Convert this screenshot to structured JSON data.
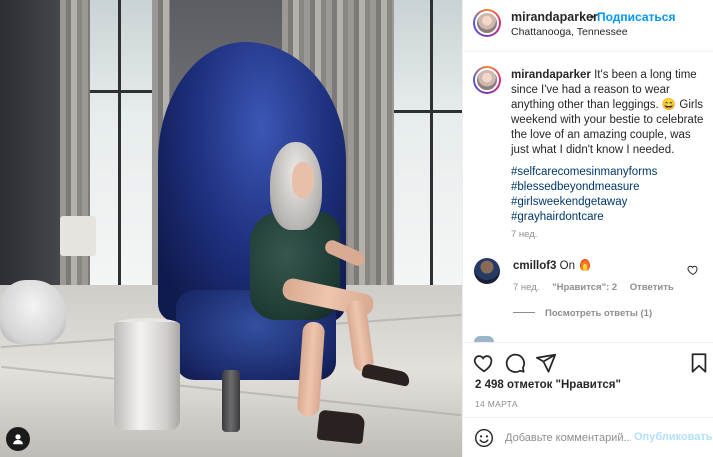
{
  "post": {
    "username": "mirandaparker",
    "follow_separator": "•",
    "follow_label": "Подписаться",
    "location": "Chattanooga, Tennessee",
    "caption": "It's been a long time since I've had a reason to wear anything other than leggings. 😄 Girls weekend with your bestie to celebrate the love of an amazing couple, was just what I didn't know I needed.",
    "hashtags": [
      "#selfcarecomesinmanyforms",
      "#blessedbeyondmeasure",
      "#girlsweekendgetaway",
      "#grayhairdontcare"
    ],
    "caption_time": "7 нед."
  },
  "comment": {
    "username": "cmillof3",
    "text": "On",
    "emoji": "fire-icon",
    "time": "7 нед.",
    "likes": "\"Нравится\": 2",
    "reply_label": "Ответить",
    "view_replies": "Посмотреть ответы (1)"
  },
  "actions": {
    "likes_count": "2 498 отметок \"Нравится\"",
    "date": "14 МАРТА",
    "comment_placeholder": "Добавьте комментарий...",
    "post_button": "Опубликовать"
  },
  "colors": {
    "accent": "#0095f6",
    "hashtag": "#00376b",
    "muted": "#8e8e8e",
    "post_disabled": "#b2dffc"
  }
}
